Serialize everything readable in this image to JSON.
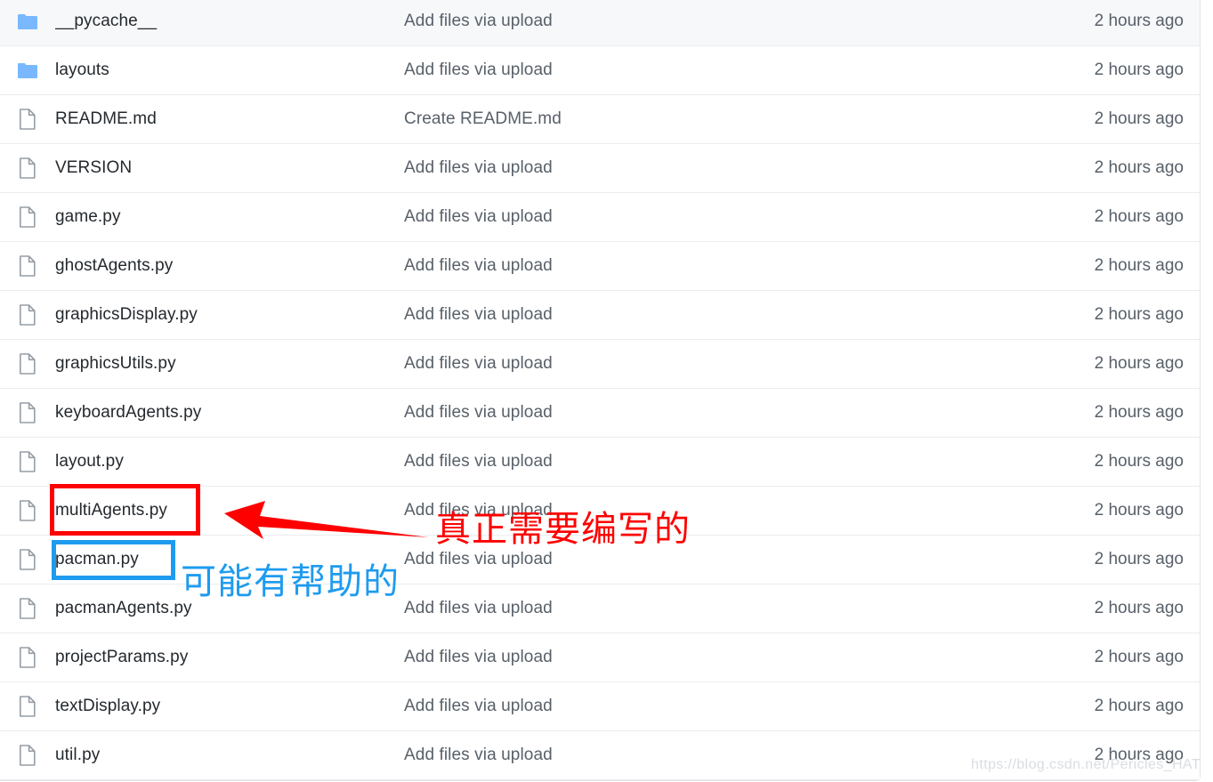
{
  "table": {
    "columns": [
      "name",
      "commit_message",
      "time"
    ],
    "rows": [
      {
        "icon": "folder-icon",
        "type": "folder",
        "name": "__pycache__",
        "message": "Add files via upload",
        "time": "2 hours ago",
        "shaded": true
      },
      {
        "icon": "folder-icon",
        "type": "folder",
        "name": "layouts",
        "message": "Add files via upload",
        "time": "2 hours ago",
        "shaded": false
      },
      {
        "icon": "file-icon",
        "type": "file",
        "name": "README.md",
        "message": "Create README.md",
        "time": "2 hours ago",
        "shaded": false
      },
      {
        "icon": "file-icon",
        "type": "file",
        "name": "VERSION",
        "message": "Add files via upload",
        "time": "2 hours ago",
        "shaded": false
      },
      {
        "icon": "file-icon",
        "type": "file",
        "name": "game.py",
        "message": "Add files via upload",
        "time": "2 hours ago",
        "shaded": false
      },
      {
        "icon": "file-icon",
        "type": "file",
        "name": "ghostAgents.py",
        "message": "Add files via upload",
        "time": "2 hours ago",
        "shaded": false
      },
      {
        "icon": "file-icon",
        "type": "file",
        "name": "graphicsDisplay.py",
        "message": "Add files via upload",
        "time": "2 hours ago",
        "shaded": false
      },
      {
        "icon": "file-icon",
        "type": "file",
        "name": "graphicsUtils.py",
        "message": "Add files via upload",
        "time": "2 hours ago",
        "shaded": false
      },
      {
        "icon": "file-icon",
        "type": "file",
        "name": "keyboardAgents.py",
        "message": "Add files via upload",
        "time": "2 hours ago",
        "shaded": false
      },
      {
        "icon": "file-icon",
        "type": "file",
        "name": "layout.py",
        "message": "Add files via upload",
        "time": "2 hours ago",
        "shaded": false
      },
      {
        "icon": "file-icon",
        "type": "file",
        "name": "multiAgents.py",
        "message": "Add files via upload",
        "time": "2 hours ago",
        "shaded": false
      },
      {
        "icon": "file-icon",
        "type": "file",
        "name": "pacman.py",
        "message": "Add files via upload",
        "time": "2 hours ago",
        "shaded": false
      },
      {
        "icon": "file-icon",
        "type": "file",
        "name": "pacmanAgents.py",
        "message": "Add files via upload",
        "time": "2 hours ago",
        "shaded": false
      },
      {
        "icon": "file-icon",
        "type": "file",
        "name": "projectParams.py",
        "message": "Add files via upload",
        "time": "2 hours ago",
        "shaded": false
      },
      {
        "icon": "file-icon",
        "type": "file",
        "name": "textDisplay.py",
        "message": "Add files via upload",
        "time": "2 hours ago",
        "shaded": false
      },
      {
        "icon": "file-icon",
        "type": "file",
        "name": "util.py",
        "message": "Add files via upload",
        "time": "2 hours ago",
        "shaded": false
      }
    ]
  },
  "annotations": {
    "red_highlight": {
      "target": "multiAgents.py",
      "box_color": "#fe0000",
      "label": "真正需要编写的",
      "label_color": "#fe0000",
      "arrow_color": "#fe0000"
    },
    "blue_highlight": {
      "target": "pacman.py",
      "box_color": "#1e9bef",
      "label": "可能有帮助的",
      "label_color": "#1e9bef"
    }
  },
  "watermark": {
    "text": "https://blog.csdn.net/Pericles_HAT",
    "color": "#d9dde2"
  },
  "theme": {
    "folder_icon_color": "#79b8ff",
    "file_icon_color": "#959da5",
    "row_shaded_bg": "#f6f8fa",
    "row_border": "#eaecef",
    "name_text_color": "#24292e",
    "meta_text_color": "#586069"
  }
}
